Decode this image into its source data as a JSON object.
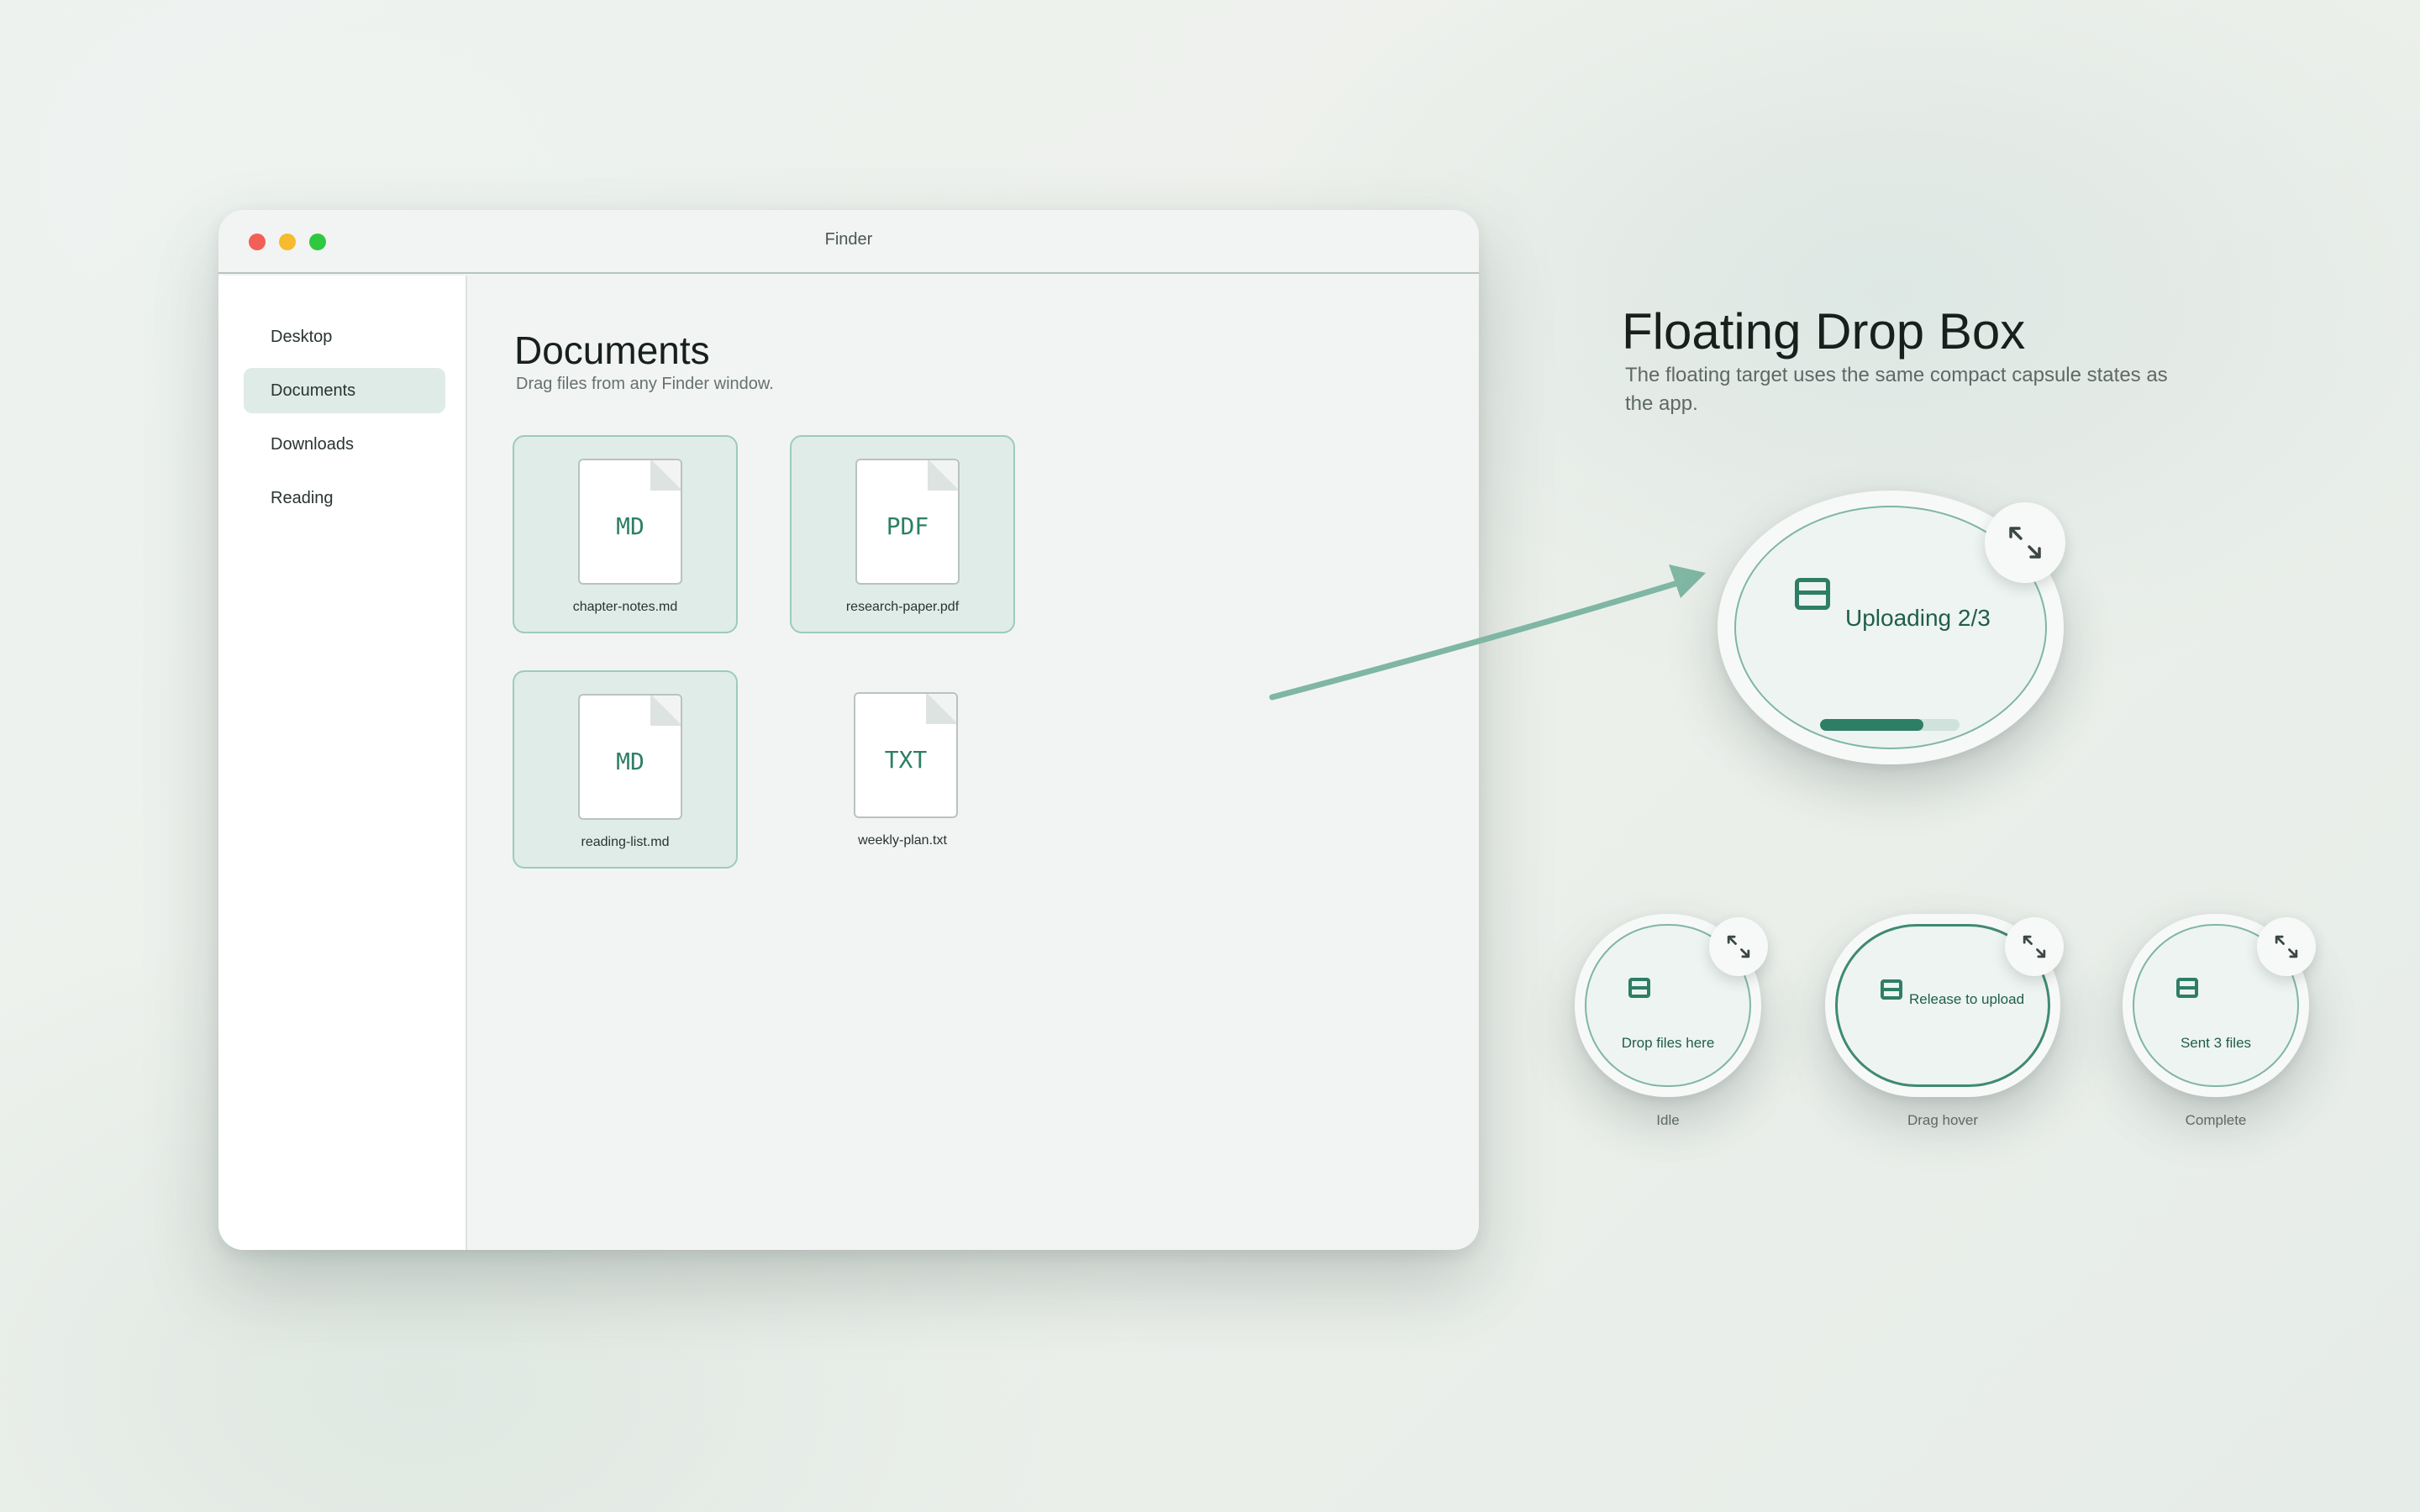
{
  "window": {
    "title": "Finder"
  },
  "sidebar": {
    "items": [
      {
        "label": "Desktop",
        "active": false
      },
      {
        "label": "Documents",
        "active": true
      },
      {
        "label": "Downloads",
        "active": false
      },
      {
        "label": "Reading",
        "active": false
      }
    ]
  },
  "main": {
    "title": "Documents",
    "subtitle": "Drag files from any Finder window.",
    "files": [
      {
        "ext": "MD",
        "name": "chapter-notes.md",
        "selected": true
      },
      {
        "ext": "PDF",
        "name": "research-paper.pdf",
        "selected": true
      },
      {
        "ext": "MD",
        "name": "reading-list.md",
        "selected": true
      },
      {
        "ext": "TXT",
        "name": "weekly-plan.txt",
        "selected": false
      }
    ]
  },
  "dropbox": {
    "title": "Floating Drop Box",
    "subtitle": "The floating target uses the same compact capsule states as the app.",
    "active": {
      "label": "Uploading 2/3",
      "progress": 0.74,
      "icon": "tray-icon"
    },
    "states": [
      {
        "label": "Drop files here",
        "caption": "Idle"
      },
      {
        "label": "Release to upload",
        "caption": "Drag hover"
      },
      {
        "label": "Sent 3 files",
        "caption": "Complete"
      }
    ]
  },
  "colors": {
    "accent": "#2e7e66",
    "accent_light": "#7fb6a4",
    "selection": "#e0ece8"
  },
  "icons": {
    "expand": "expand-arrows-icon",
    "tray": "tray-icon",
    "drag_arrow": "drag-arrow-icon"
  }
}
